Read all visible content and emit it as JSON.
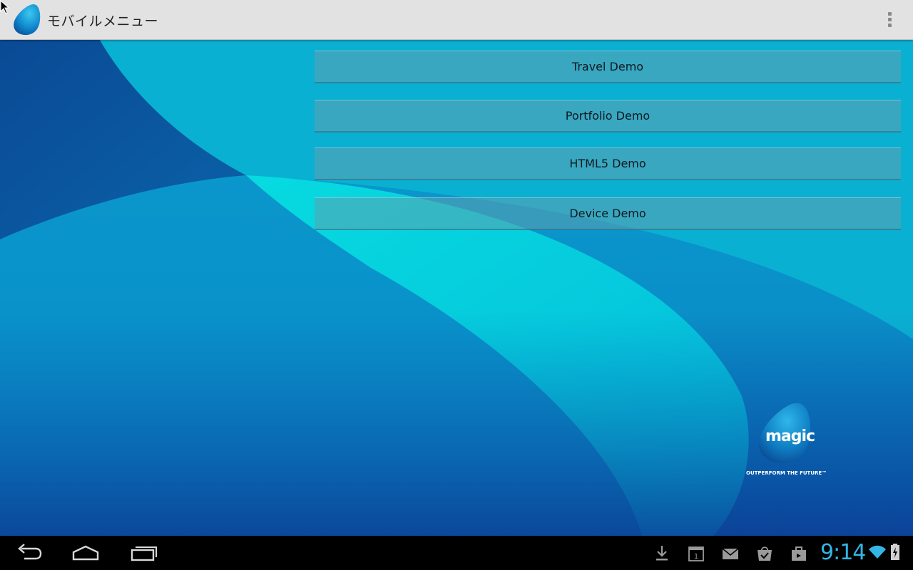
{
  "action_bar": {
    "title": "モバイルメニュー",
    "app_icon": "magic-drop-icon",
    "overflow_icon": "overflow-menu-icon"
  },
  "menu": {
    "buttons": [
      {
        "label": "Travel Demo"
      },
      {
        "label": "Portfolio Demo"
      },
      {
        "label": "HTML5 Demo"
      },
      {
        "label": "Device Demo"
      }
    ]
  },
  "branding": {
    "logo_word": "magic",
    "tagline": "OUTPERFORM THE FUTURE™",
    "logo_icon": "magic-drop-icon"
  },
  "system_bar": {
    "nav": [
      "back-icon",
      "home-icon",
      "recent-apps-icon"
    ],
    "notifications": [
      "download-icon",
      "calendar-icon",
      "mail-icon",
      "store-update-icon",
      "briefcase-icon"
    ],
    "calendar_day": "1",
    "clock": "9:14",
    "status": [
      "wifi-icon",
      "battery-charging-icon"
    ]
  },
  "colors": {
    "accent_clock": "#33b5e5",
    "action_bar": "#e2e2e2",
    "bg_dark_blue": "#0a4e9a",
    "bg_cyan": "#06c6db"
  }
}
